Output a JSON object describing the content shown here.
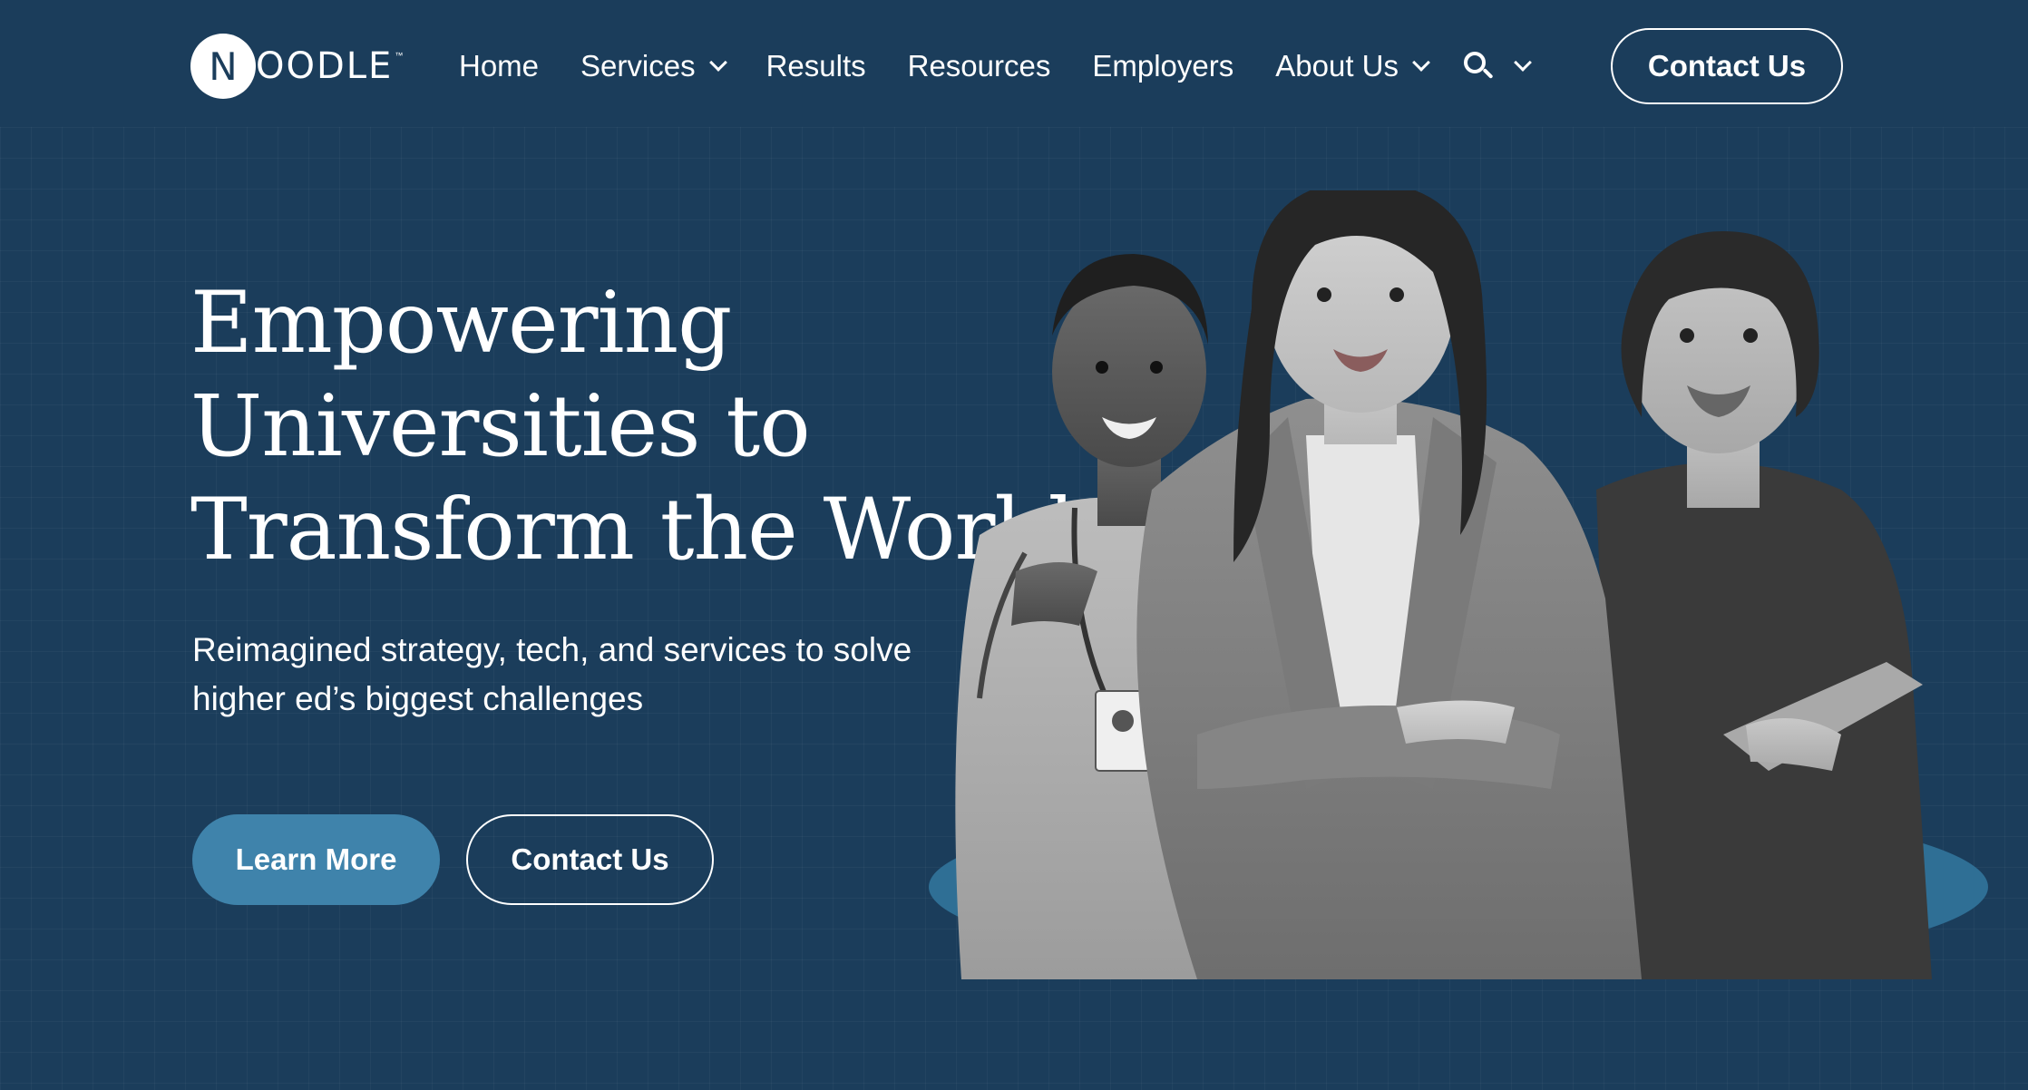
{
  "brand": {
    "logo_letter": "N",
    "logo_rest": "OODLE",
    "logo_tm": "™"
  },
  "nav": {
    "items": [
      {
        "label": "Home",
        "has_dropdown": false
      },
      {
        "label": "Services",
        "has_dropdown": true
      },
      {
        "label": "Results",
        "has_dropdown": false
      },
      {
        "label": "Resources",
        "has_dropdown": false
      },
      {
        "label": "Employers",
        "has_dropdown": false
      },
      {
        "label": "About Us",
        "has_dropdown": true
      }
    ],
    "search_icon": "search-icon",
    "contact_label": "Contact Us"
  },
  "hero": {
    "title_line1": "Empowering",
    "title_line2": "Universities to",
    "title_line3": "Transform the World",
    "subtitle_line1": "Reimagined strategy, tech, and services to solve",
    "subtitle_line2": "higher ed’s biggest challenges",
    "learn_more_label": "Learn More",
    "contact_label": "Contact Us"
  },
  "colors": {
    "background": "#1b3d5b",
    "accent": "#3f83ab",
    "ellipse": "#2f6f95"
  }
}
